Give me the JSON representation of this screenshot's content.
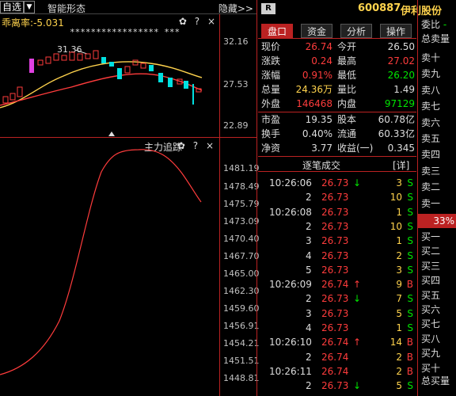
{
  "topbar": {
    "select_label": "自选",
    "dropdown_glyph": "▼",
    "mode_label": "智能形态",
    "hide_label": "隐藏>>"
  },
  "kpanel": {
    "deviation_label": "乖离率",
    "deviation_value": "-5.031",
    "gear_glyph": "✿",
    "help_glyph": "?",
    "close_glyph": "×",
    "high_marker": "31.36",
    "stars": "***************** ***",
    "y_labels": [
      "32.16",
      "27.53",
      "22.89"
    ]
  },
  "ipanel": {
    "title": "主力追踪",
    "gear_glyph": "✿",
    "help_glyph": "?",
    "close_glyph": "×",
    "y_labels": [
      "1481.19",
      "1478.49",
      "1475.79",
      "1473.09",
      "1470.40",
      "1467.70",
      "1465.00",
      "1462.30",
      "1459.60",
      "1456.91",
      "1454.21",
      "1451.51",
      "1448.81"
    ]
  },
  "header": {
    "r_badge": "R",
    "code": "600887",
    "name": "伊利股份"
  },
  "tabs": [
    "盘口",
    "资金",
    "分析",
    "操作"
  ],
  "quote": {
    "rows": [
      {
        "l1": "现价",
        "v1": "26.74",
        "c1": "red",
        "l2": "今开",
        "v2": "26.50",
        "c2": "white"
      },
      {
        "l1": "涨跌",
        "v1": "0.24",
        "c1": "red",
        "l2": "最高",
        "v2": "27.02",
        "c2": "red"
      },
      {
        "l1": "涨幅",
        "v1": "0.91%",
        "c1": "red",
        "l2": "最低",
        "v2": "26.20",
        "c2": "green"
      },
      {
        "l1": "总量",
        "v1": "24.36万",
        "c1": "yellow",
        "l2": "量比",
        "v2": "1.49",
        "c2": "white"
      },
      {
        "l1": "外盘",
        "v1": "146468",
        "c1": "red",
        "l2": "内盘",
        "v2": "97129",
        "c2": "green"
      }
    ],
    "rows2": [
      {
        "l1": "市盈",
        "v1": "19.35",
        "l2": "股本",
        "v2": "60.78亿"
      },
      {
        "l1": "换手",
        "v1": "0.40%",
        "l2": "流通",
        "v2": "60.33亿"
      },
      {
        "l1": "净资",
        "v1": "3.77",
        "l2": "收益(一)",
        "v2": "0.345"
      }
    ]
  },
  "trades": {
    "title": "逐笔成交",
    "detail": "[详]",
    "rows": [
      {
        "time": "10:26:06",
        "price": "26.73",
        "arrow": "↓",
        "vol": "3",
        "side": "S"
      },
      {
        "time": "2",
        "price": "26.73",
        "arrow": "",
        "vol": "10",
        "side": "S"
      },
      {
        "time": "10:26:08",
        "price": "26.73",
        "arrow": "",
        "vol": "1",
        "side": "S"
      },
      {
        "time": "2",
        "price": "26.73",
        "arrow": "",
        "vol": "10",
        "side": "S"
      },
      {
        "time": "3",
        "price": "26.73",
        "arrow": "",
        "vol": "1",
        "side": "S"
      },
      {
        "time": "4",
        "price": "26.73",
        "arrow": "",
        "vol": "2",
        "side": "S"
      },
      {
        "time": "5",
        "price": "26.73",
        "arrow": "",
        "vol": "3",
        "side": "S"
      },
      {
        "time": "10:26:09",
        "price": "26.74",
        "arrow": "↑",
        "vol": "9",
        "side": "B"
      },
      {
        "time": "2",
        "price": "26.73",
        "arrow": "↓",
        "vol": "7",
        "side": "S"
      },
      {
        "time": "3",
        "price": "26.73",
        "arrow": "",
        "vol": "5",
        "side": "S"
      },
      {
        "time": "4",
        "price": "26.73",
        "arrow": "",
        "vol": "1",
        "side": "S"
      },
      {
        "time": "10:26:10",
        "price": "26.74",
        "arrow": "↑",
        "vol": "14",
        "side": "B"
      },
      {
        "time": "2",
        "price": "26.74",
        "arrow": "",
        "vol": "2",
        "side": "B"
      },
      {
        "time": "10:26:11",
        "price": "26.74",
        "arrow": "",
        "vol": "2",
        "side": "B"
      },
      {
        "time": "2",
        "price": "26.73",
        "arrow": "↓",
        "vol": "5",
        "side": "S"
      }
    ]
  },
  "orderbook": {
    "top_label": "委比",
    "top_value": "-",
    "sell_total": "总卖量",
    "sells": [
      "卖十",
      "卖九",
      "卖八",
      "卖七",
      "卖六",
      "卖五",
      "卖四",
      "卖三",
      "卖二",
      "卖一"
    ],
    "pct": "33%",
    "buys": [
      "买一",
      "买二",
      "买三",
      "买四",
      "买五",
      "买六",
      "买七",
      "买八",
      "买九",
      "买十"
    ],
    "buy_total": "总买量"
  },
  "colors": {
    "up": "#ff3c3c",
    "down": "#00e600",
    "accent": "#ffd34d",
    "divider": "#b22222"
  }
}
